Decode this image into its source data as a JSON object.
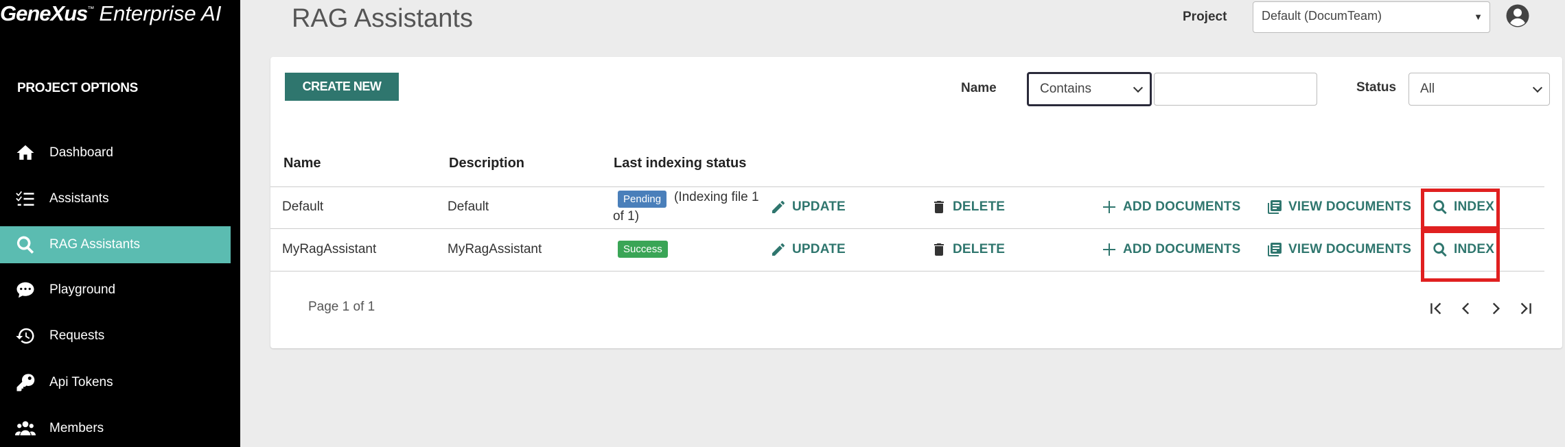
{
  "app": {
    "brand_name": "GeneXus",
    "brand_tm": "™",
    "brand_product": "Enterprise AI"
  },
  "sidebar": {
    "section_title": "PROJECT OPTIONS",
    "items": [
      {
        "label": "Dashboard",
        "icon": "home-icon"
      },
      {
        "label": "Assistants",
        "icon": "checklist-icon"
      },
      {
        "label": "RAG Assistants",
        "icon": "search-icon",
        "active": true
      },
      {
        "label": "Playground",
        "icon": "chat-icon"
      },
      {
        "label": "Requests",
        "icon": "history-icon"
      },
      {
        "label": "Api Tokens",
        "icon": "key-icon"
      },
      {
        "label": "Members",
        "icon": "users-icon"
      }
    ]
  },
  "header": {
    "title": "RAG Assistants",
    "project_label": "Project",
    "project_value": "Default (DocumTeam)"
  },
  "toolbar": {
    "create_label": "CREATE NEW",
    "name_label": "Name",
    "name_operator": "Contains",
    "name_value": "",
    "status_label": "Status",
    "status_value": "All"
  },
  "table": {
    "columns": [
      "Name",
      "Description",
      "Last indexing status"
    ],
    "rows": [
      {
        "name": "Default",
        "description": "Default",
        "status": "Pending",
        "status_note": "(Indexing file 1 of 1)"
      },
      {
        "name": "MyRagAssistant",
        "description": "MyRagAssistant",
        "status": "Success",
        "status_note": ""
      }
    ],
    "actions": {
      "update": "UPDATE",
      "delete": "DELETE",
      "add_documents": "ADD DOCUMENTS",
      "view_documents": "VIEW DOCUMENTS",
      "index": "INDEX"
    }
  },
  "pager": {
    "text": "Page 1 of 1"
  },
  "colors": {
    "accent": "#2f766e",
    "sidebar_active": "#5bbcb1",
    "highlight": "#e02020",
    "pending": "#4a7fba",
    "success": "#3aa556"
  }
}
